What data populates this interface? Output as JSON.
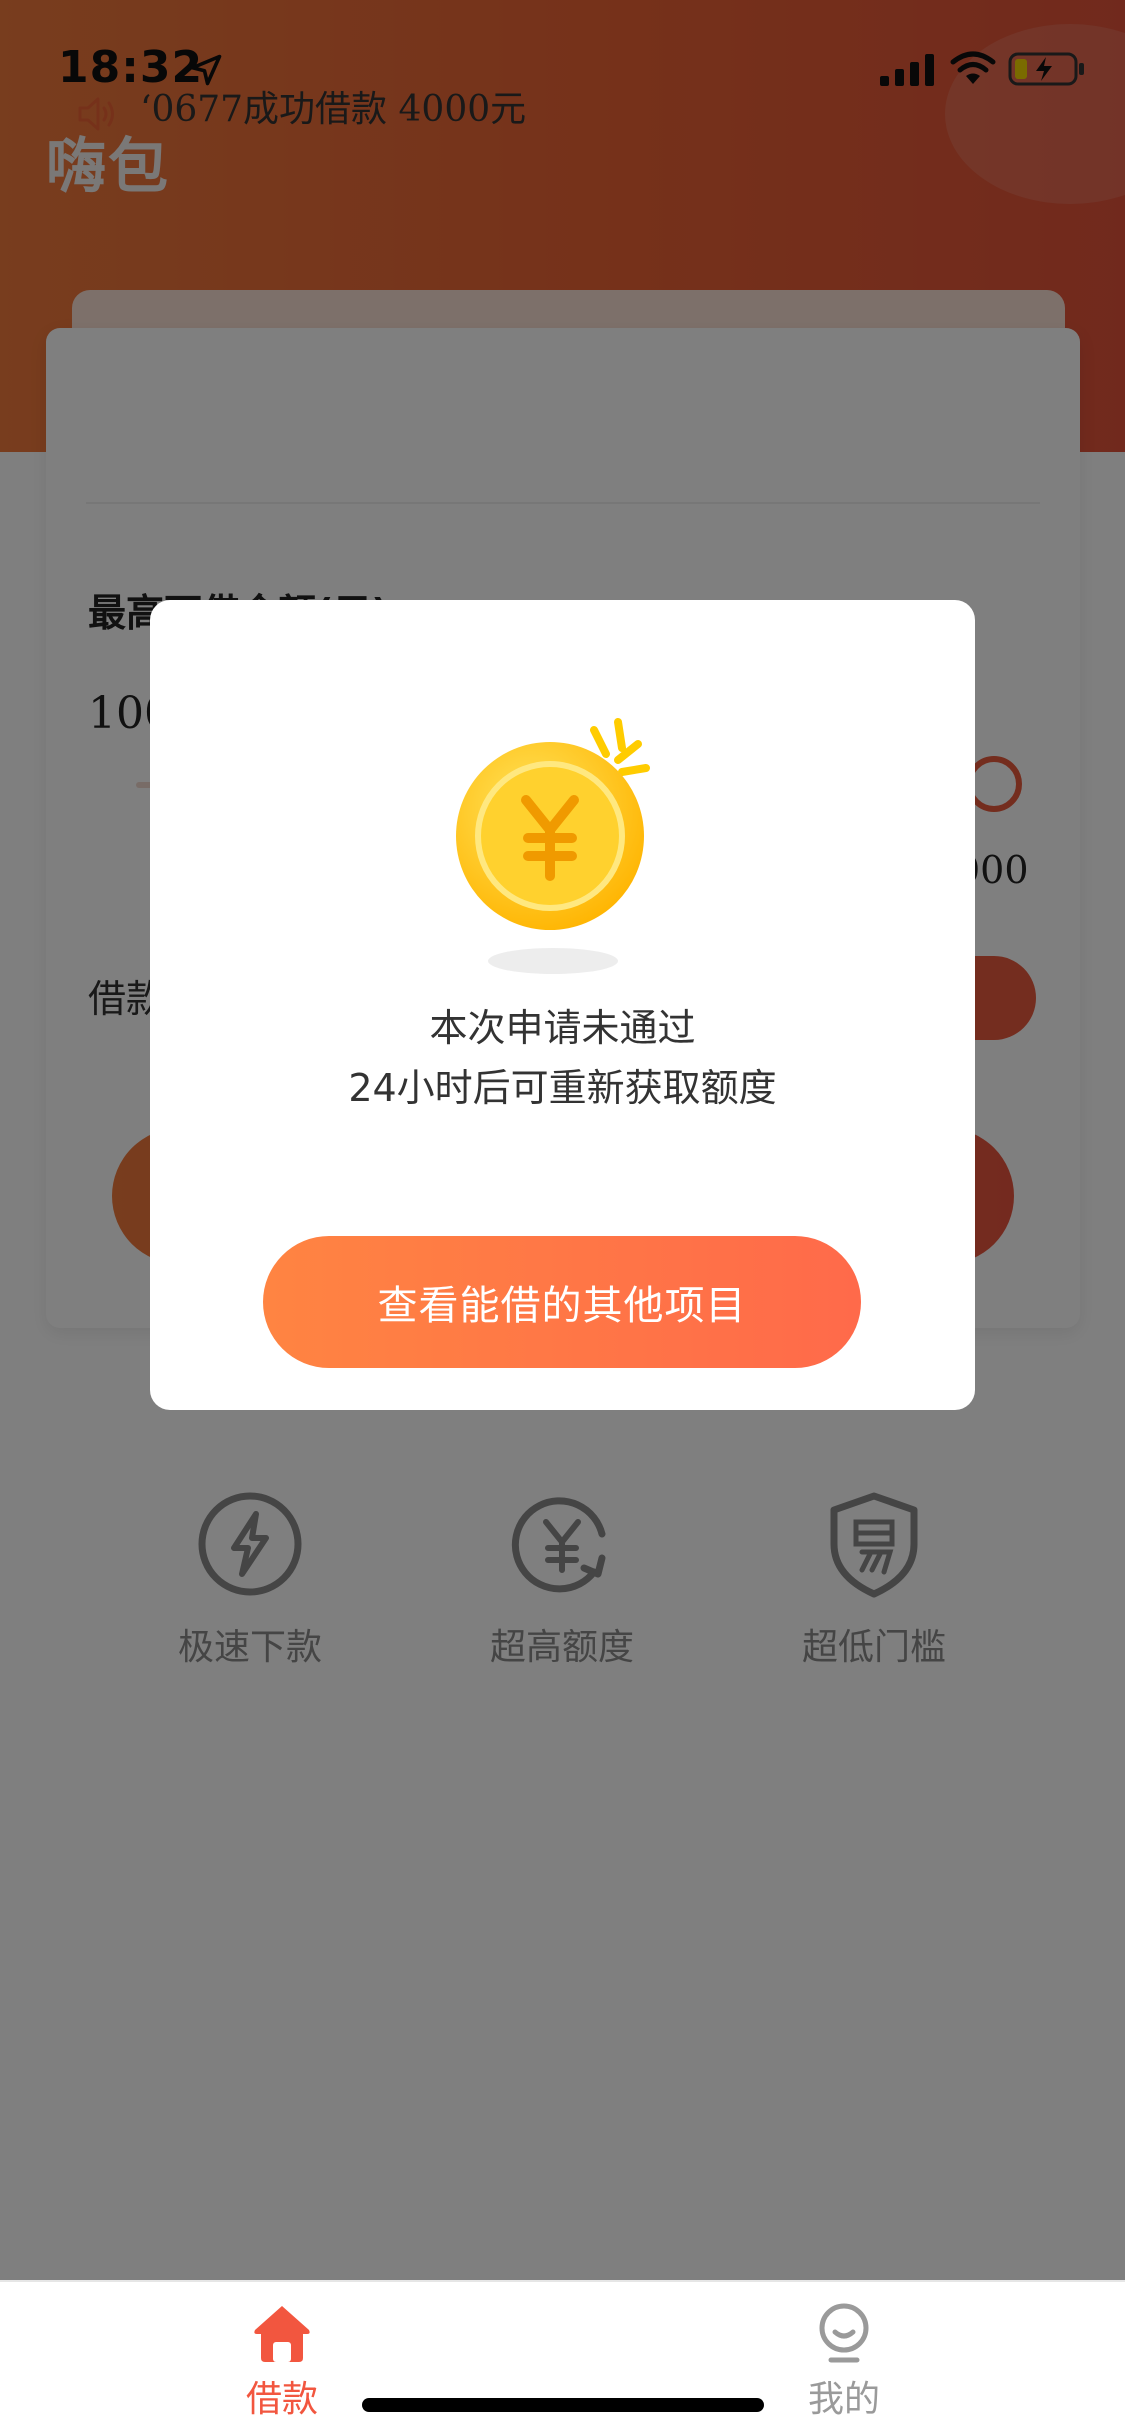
{
  "status_bar": {
    "time": "18:32"
  },
  "app": {
    "title": "嗨包"
  },
  "card": {
    "notice_text": "‘0677成功借款 4000元",
    "limit_label": "最高可借金额(元)",
    "limit_amount": "100",
    "slider_max": "000",
    "term_label": "借款"
  },
  "features": [
    {
      "label": "极速下款",
      "icon": "lightning-icon"
    },
    {
      "label": "超高额度",
      "icon": "yuan-refresh-icon"
    },
    {
      "label": "超低门槛",
      "icon": "shield-easy-icon"
    }
  ],
  "modal": {
    "line1": "本次申请未通过",
    "line2": "24小时后可重新获取额度",
    "button_label": "查看能借的其他项目"
  },
  "tabbar": {
    "items": [
      {
        "label": "借款",
        "active": true,
        "icon": "home-icon"
      },
      {
        "label": "我的",
        "active": false,
        "icon": "profile-icon"
      }
    ],
    "active_color": "#f2563f",
    "inactive_color": "#9a9a9a"
  },
  "colors": {
    "accent": "#ec6335",
    "button_gradient_start": "#ff8442",
    "button_gradient_end": "#ff6a4a"
  }
}
